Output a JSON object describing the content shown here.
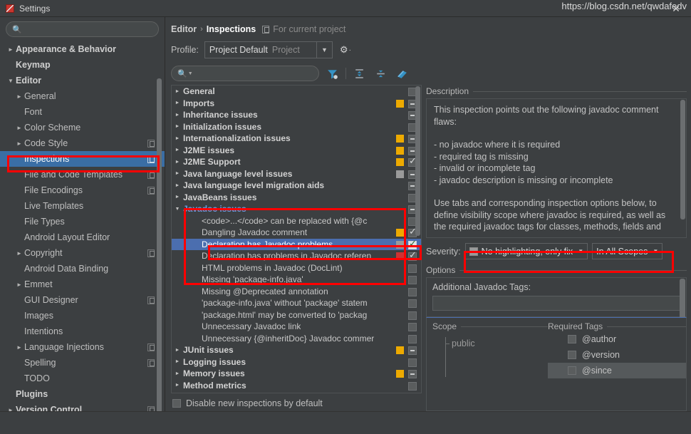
{
  "window": {
    "title": "Settings",
    "app_icon": "intellij-icon",
    "close_label": "✕"
  },
  "sidebar": {
    "search_placeholder": "",
    "search_value": "",
    "items": [
      {
        "label": "Appearance & Behavior",
        "arrow": "collapsed",
        "bold": true,
        "indent": 0,
        "badge": false
      },
      {
        "label": "Keymap",
        "arrow": "none",
        "bold": true,
        "indent": 0,
        "badge": false
      },
      {
        "label": "Editor",
        "arrow": "expanded",
        "bold": true,
        "indent": 0,
        "badge": false
      },
      {
        "label": "General",
        "arrow": "collapsed",
        "bold": false,
        "indent": 1,
        "badge": false
      },
      {
        "label": "Font",
        "arrow": "none",
        "bold": false,
        "indent": 1,
        "badge": false
      },
      {
        "label": "Color Scheme",
        "arrow": "collapsed",
        "bold": false,
        "indent": 1,
        "badge": false
      },
      {
        "label": "Code Style",
        "arrow": "collapsed",
        "bold": false,
        "indent": 1,
        "badge": true
      },
      {
        "label": "Inspections",
        "arrow": "none",
        "bold": false,
        "indent": 1,
        "badge": true,
        "selected": true
      },
      {
        "label": "File and Code Templates",
        "arrow": "none",
        "bold": false,
        "indent": 1,
        "badge": true
      },
      {
        "label": "File Encodings",
        "arrow": "none",
        "bold": false,
        "indent": 1,
        "badge": true
      },
      {
        "label": "Live Templates",
        "arrow": "none",
        "bold": false,
        "indent": 1,
        "badge": false
      },
      {
        "label": "File Types",
        "arrow": "none",
        "bold": false,
        "indent": 1,
        "badge": false
      },
      {
        "label": "Android Layout Editor",
        "arrow": "none",
        "bold": false,
        "indent": 1,
        "badge": false
      },
      {
        "label": "Copyright",
        "arrow": "collapsed",
        "bold": false,
        "indent": 1,
        "badge": true
      },
      {
        "label": "Android Data Binding",
        "arrow": "none",
        "bold": false,
        "indent": 1,
        "badge": false
      },
      {
        "label": "Emmet",
        "arrow": "collapsed",
        "bold": false,
        "indent": 1,
        "badge": false
      },
      {
        "label": "GUI Designer",
        "arrow": "none",
        "bold": false,
        "indent": 1,
        "badge": true
      },
      {
        "label": "Images",
        "arrow": "none",
        "bold": false,
        "indent": 1,
        "badge": false
      },
      {
        "label": "Intentions",
        "arrow": "none",
        "bold": false,
        "indent": 1,
        "badge": false
      },
      {
        "label": "Language Injections",
        "arrow": "collapsed",
        "bold": false,
        "indent": 1,
        "badge": true
      },
      {
        "label": "Spelling",
        "arrow": "none",
        "bold": false,
        "indent": 1,
        "badge": true
      },
      {
        "label": "TODO",
        "arrow": "none",
        "bold": false,
        "indent": 1,
        "badge": false
      },
      {
        "label": "Plugins",
        "arrow": "none",
        "bold": true,
        "indent": 0,
        "badge": false
      },
      {
        "label": "Version Control",
        "arrow": "collapsed",
        "bold": true,
        "indent": 0,
        "badge": true
      }
    ]
  },
  "breadcrumb": {
    "parent": "Editor",
    "separator": "›",
    "current": "Inspections",
    "scope_note": "For current project"
  },
  "profile": {
    "label": "Profile:",
    "value": "Project Default",
    "value_suffix": "Project",
    "caret": "▼",
    "gear_icon": "gear-icon"
  },
  "filter_toolbar": {
    "search_value": "",
    "search_placeholder": "",
    "icons": [
      "filter-funnel-icon",
      "expand-all-icon",
      "collapse-all-icon",
      "reset-highlight-icon"
    ]
  },
  "inspection_tree": {
    "rows": [
      {
        "label": "General",
        "type": "group",
        "arrow": "collapsed",
        "severity": "",
        "check": "none"
      },
      {
        "label": "Imports",
        "type": "group",
        "arrow": "collapsed",
        "severity": "yellow",
        "check": "dash"
      },
      {
        "label": "Inheritance issues",
        "type": "group",
        "arrow": "collapsed",
        "severity": "",
        "check": "dash"
      },
      {
        "label": "Initialization issues",
        "type": "group",
        "arrow": "collapsed",
        "severity": "",
        "check": "none"
      },
      {
        "label": "Internationalization issues",
        "type": "group",
        "arrow": "collapsed",
        "severity": "yellow",
        "check": "dash"
      },
      {
        "label": "J2ME issues",
        "type": "group",
        "arrow": "collapsed",
        "severity": "yellow",
        "check": "dash"
      },
      {
        "label": "J2ME Support",
        "type": "group",
        "arrow": "collapsed",
        "severity": "yellow",
        "check": "check"
      },
      {
        "label": "Java language level issues",
        "type": "group",
        "arrow": "collapsed",
        "severity": "gray",
        "check": "dash"
      },
      {
        "label": "Java language level migration aids",
        "type": "group",
        "arrow": "collapsed",
        "severity": "",
        "check": "dash"
      },
      {
        "label": "JavaBeans issues",
        "type": "group",
        "arrow": "collapsed",
        "severity": "",
        "check": "none"
      },
      {
        "label": "Javadoc issues",
        "type": "group",
        "arrow": "expanded",
        "severity": "",
        "check": "dash"
      },
      {
        "label": "<code>...</code> can be replaced with {@c",
        "type": "child",
        "arrow": "none",
        "severity": "",
        "check": "none"
      },
      {
        "label": "Dangling Javadoc comment",
        "type": "child",
        "arrow": "none",
        "severity": "yellow",
        "check": "check"
      },
      {
        "label": "Declaration has Javadoc problems",
        "type": "child",
        "arrow": "none",
        "severity": "gray",
        "check": "check",
        "selected": true
      },
      {
        "label": "Declaration has problems in Javadoc referen",
        "type": "child",
        "arrow": "none",
        "severity": "red",
        "check": "check"
      },
      {
        "label": "HTML problems in Javadoc (DocLint)",
        "type": "child",
        "arrow": "none",
        "severity": "",
        "check": "none"
      },
      {
        "label": "Missing 'package-info.java'",
        "type": "child",
        "arrow": "none",
        "severity": "",
        "check": "none"
      },
      {
        "label": "Missing @Deprecated annotation",
        "type": "child",
        "arrow": "none",
        "severity": "",
        "check": "none"
      },
      {
        "label": "'package-info.java' without 'package' statem",
        "type": "child",
        "arrow": "none",
        "severity": "",
        "check": "none"
      },
      {
        "label": "'package.html' may be converted to 'packag",
        "type": "child",
        "arrow": "none",
        "severity": "",
        "check": "none"
      },
      {
        "label": "Unnecessary Javadoc link",
        "type": "child",
        "arrow": "none",
        "severity": "",
        "check": "none"
      },
      {
        "label": "Unnecessary {@inheritDoc} Javadoc commer",
        "type": "child",
        "arrow": "none",
        "severity": "",
        "check": "none"
      },
      {
        "label": "JUnit issues",
        "type": "group",
        "arrow": "collapsed",
        "severity": "yellow",
        "check": "dash"
      },
      {
        "label": "Logging issues",
        "type": "group",
        "arrow": "collapsed",
        "severity": "",
        "check": "none"
      },
      {
        "label": "Memory issues",
        "type": "group",
        "arrow": "collapsed",
        "severity": "yellow",
        "check": "dash"
      },
      {
        "label": "Method metrics",
        "type": "group",
        "arrow": "collapsed",
        "severity": "",
        "check": "none"
      }
    ],
    "disable_new_label": "Disable new inspections by default",
    "disable_new_checked": false
  },
  "description": {
    "header": "Description",
    "lines": [
      "This inspection points out the following javadoc comment",
      "flaws:",
      "",
      "- no javadoc where it is required",
      "- required tag is missing",
      "- invalid or incomplete tag",
      "- javadoc description is missing or incomplete",
      "",
      "Use tabs and corresponding inspection options below, to",
      "define visibility scope where javadoc is required, as well as",
      "the required javadoc tags for classes, methods, fields and"
    ]
  },
  "severity": {
    "label": "Severity:",
    "value": "No highlighting, only fix",
    "swatch_color": "#9a9a9a",
    "caret": "▼",
    "scope_value": "In All Scopes",
    "scope_caret": "▼"
  },
  "options": {
    "header": "Options",
    "tags_label": "Additional Javadoc Tags:",
    "tags_value": "",
    "scope_header": "Scope",
    "required_tags_header": "Required Tags",
    "scope_items": [
      {
        "label": "public"
      }
    ],
    "tag_items": [
      {
        "label": "@author",
        "checked": false,
        "highlight": false
      },
      {
        "label": "@version",
        "checked": false,
        "highlight": false
      },
      {
        "label": "@since",
        "checked": false,
        "highlight": true
      }
    ]
  },
  "watermark": "https://blog.csdn.net/qwdafedv"
}
